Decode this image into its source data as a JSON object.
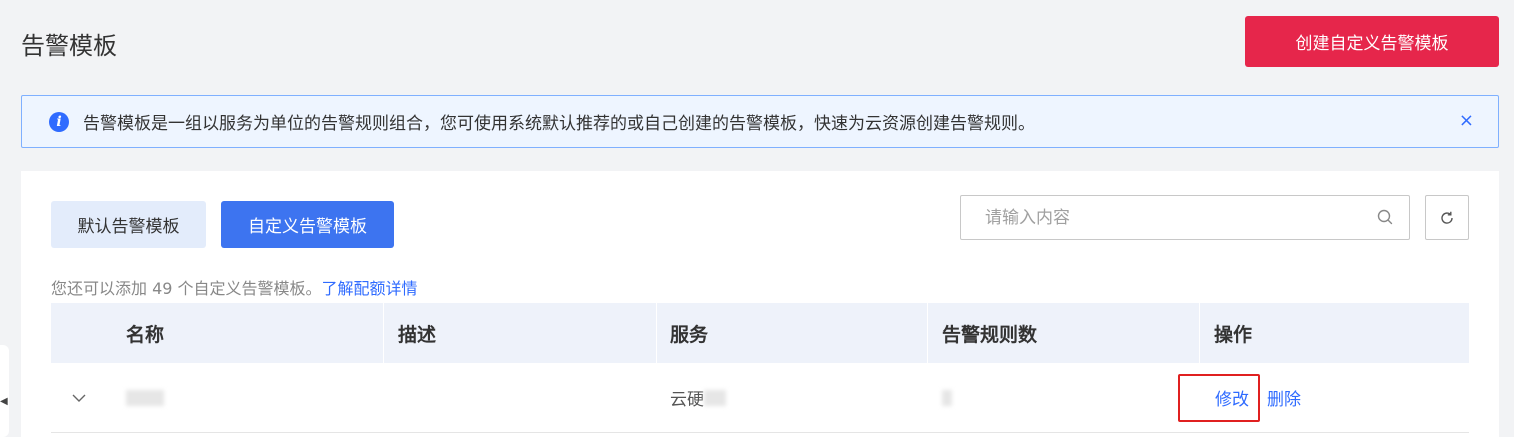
{
  "header": {
    "title": "告警模板",
    "create_button": "创建自定义告警模板"
  },
  "notice": {
    "text": "告警模板是一组以服务为单位的告警规则组合，您可使用系统默认推荐的或自己创建的告警模板，快速为云资源创建告警规则。",
    "close": "×"
  },
  "tabs": [
    {
      "label": "默认告警模板",
      "active": false
    },
    {
      "label": "自定义告警模板",
      "active": true
    }
  ],
  "search": {
    "placeholder": "请输入内容"
  },
  "quota": {
    "text": "您还可以添加 49 个自定义告警模板。",
    "link": "了解配额详情"
  },
  "table": {
    "columns": [
      "名称",
      "描述",
      "服务",
      "告警规则数",
      "操作"
    ],
    "rows": [
      {
        "service_prefix": "云硬",
        "actions": {
          "edit": "修改",
          "delete": "删除"
        }
      }
    ]
  },
  "colors": {
    "primary": "#2f6bff",
    "danger": "#e6264b",
    "tab_active": "#3d74f0"
  },
  "icons": [
    "info-icon",
    "close-icon",
    "search-icon",
    "refresh-icon",
    "chevron-down-icon"
  ]
}
